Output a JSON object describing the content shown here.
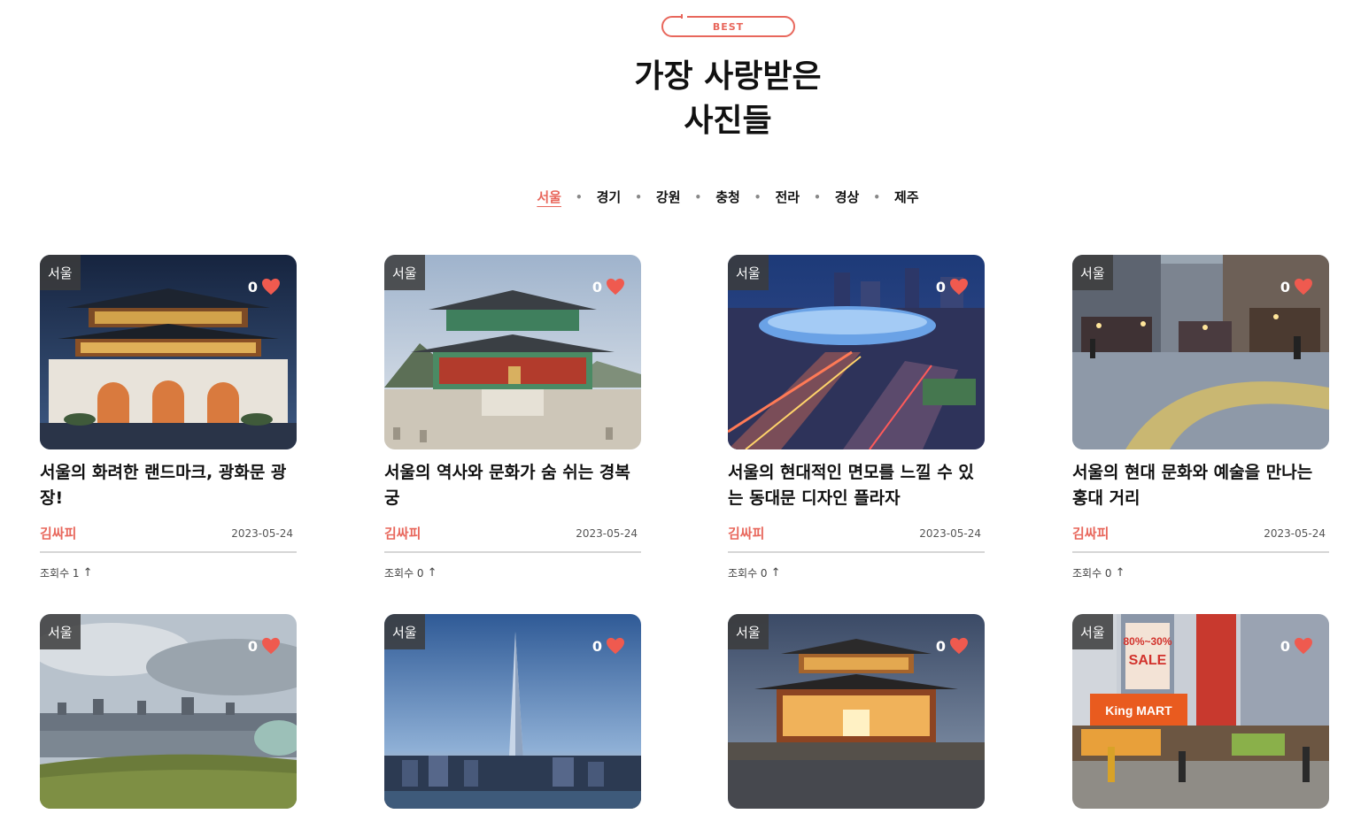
{
  "section": {
    "badge": "BEST",
    "title_line1": "가장 사랑받은",
    "title_line2": "사진들"
  },
  "tabs": [
    "서울",
    "경기",
    "강원",
    "충청",
    "전라",
    "경상",
    "제주"
  ],
  "active_tab": "서울",
  "cards": [
    {
      "region": "서울",
      "likes": "0",
      "title": "서울의 화려한 랜드마크, 광화문 광장!",
      "author": "김싸피",
      "date": "2023-05-24",
      "views": "조회수 1"
    },
    {
      "region": "서울",
      "likes": "0",
      "title": "서울의 역사와 문화가 숨 쉬는 경복궁",
      "author": "김싸피",
      "date": "2023-05-24",
      "views": "조회수 0"
    },
    {
      "region": "서울",
      "likes": "0",
      "title": "서울의 현대적인 면모를 느낄 수 있는 동대문 디자인 플라자",
      "author": "김싸피",
      "date": "2023-05-24",
      "views": "조회수 0"
    },
    {
      "region": "서울",
      "likes": "0",
      "title": "서울의 현대 문화와 예술을 만나는 홍대 거리",
      "author": "김싸피",
      "date": "2023-05-24",
      "views": "조회수 0"
    },
    {
      "region": "서울",
      "likes": "0"
    },
    {
      "region": "서울",
      "likes": "0"
    },
    {
      "region": "서울",
      "likes": "0"
    },
    {
      "region": "서울",
      "likes": "0"
    }
  ],
  "photo_signs": {
    "sale_sign": "SALE",
    "discount_sign": "80%~30%",
    "store_sign": "King MART"
  },
  "colors": {
    "accent": "#e8675c",
    "heart": "#ef5a4f",
    "divider": "#d6d6d6"
  }
}
